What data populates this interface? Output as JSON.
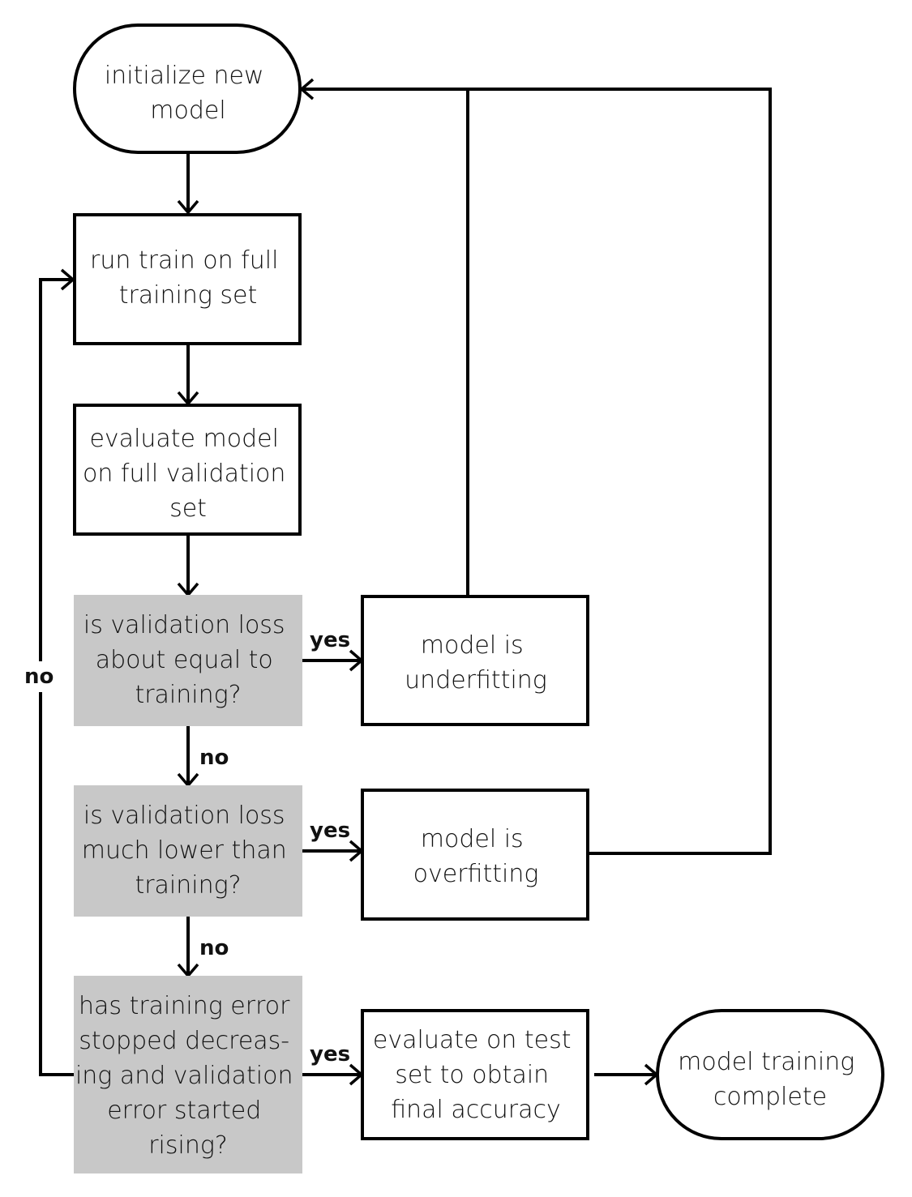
{
  "colors": {
    "stroke": "#000000",
    "decision_fill": "#c8c8c8",
    "process_fill": "#ffffff",
    "text": "#111111"
  },
  "nodes": {
    "start": {
      "type": "terminal",
      "lines": [
        "initialize new",
        "model"
      ]
    },
    "train": {
      "type": "process",
      "lines": [
        "run train on full",
        "training set"
      ]
    },
    "evaluate": {
      "type": "process",
      "lines": [
        "evaluate model",
        "on full validation",
        "set"
      ]
    },
    "q_equal": {
      "type": "decision",
      "lines": [
        "is validation loss",
        "about equal to",
        "training?"
      ]
    },
    "q_lower": {
      "type": "decision",
      "lines": [
        "is validation loss",
        "much lower than",
        "training?"
      ]
    },
    "q_stopped": {
      "type": "decision",
      "lines": [
        "has training error",
        "stopped decreas-",
        "ing and validation",
        "error started",
        "rising?"
      ]
    },
    "underfitting": {
      "type": "process",
      "lines": [
        "model is",
        "underfitting"
      ]
    },
    "overfitting": {
      "type": "process",
      "lines": [
        "model is",
        "overfitting"
      ]
    },
    "test": {
      "type": "process",
      "lines": [
        "evaluate on test",
        "set to obtain",
        "final accuracy"
      ]
    },
    "end": {
      "type": "terminal",
      "lines": [
        "model training",
        "complete"
      ]
    }
  },
  "edges": [
    {
      "from": "start",
      "to": "train",
      "label": ""
    },
    {
      "from": "train",
      "to": "evaluate",
      "label": ""
    },
    {
      "from": "evaluate",
      "to": "q_equal",
      "label": ""
    },
    {
      "from": "q_equal",
      "to": "underfitting",
      "label": "yes"
    },
    {
      "from": "q_equal",
      "to": "q_lower",
      "label": "no"
    },
    {
      "from": "q_lower",
      "to": "overfitting",
      "label": "yes"
    },
    {
      "from": "q_lower",
      "to": "q_stopped",
      "label": "no"
    },
    {
      "from": "q_stopped",
      "to": "test",
      "label": "yes"
    },
    {
      "from": "q_stopped",
      "to": "train",
      "label": "no"
    },
    {
      "from": "underfitting",
      "to": "start",
      "label": ""
    },
    {
      "from": "overfitting",
      "to": "start",
      "label": ""
    },
    {
      "from": "test",
      "to": "end",
      "label": ""
    }
  ]
}
